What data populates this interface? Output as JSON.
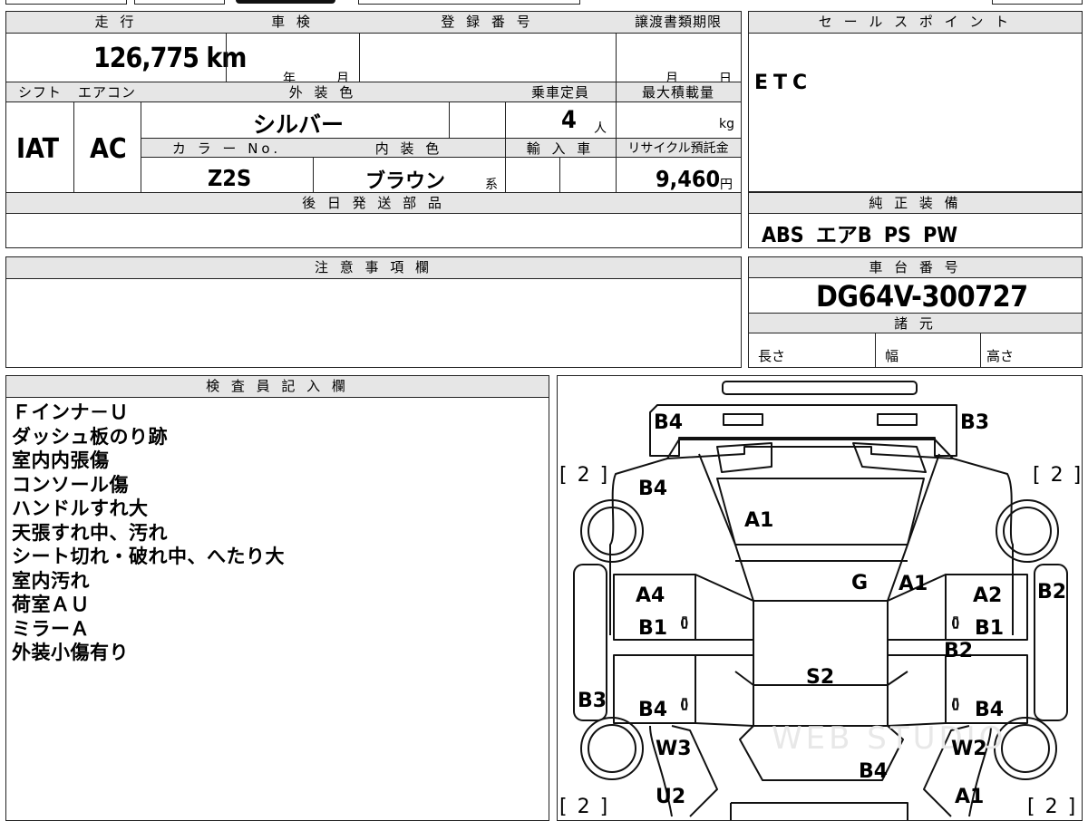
{
  "top_table": {
    "h_mileage": "走 行",
    "h_shaken": "車 検",
    "h_registration": "登 録 番 号",
    "h_transfer_deadline": "譲渡書類期限",
    "mileage": "126,775 km",
    "shaken_year_unit": "年",
    "shaken_month_unit": "月",
    "transfer_month_unit": "月",
    "transfer_day_unit": "日",
    "h_shift": "シフト",
    "h_aircon": "エアコン",
    "h_exterior_color": "外 装 色",
    "h_capacity": "乗車定員",
    "h_max_load": "最大積載量",
    "shift": "IAT",
    "aircon": "AC",
    "exterior_color": "シルバー",
    "capacity": "4",
    "capacity_unit": "人",
    "max_load_unit": "kg",
    "h_color_no": "カ ラ ー No.",
    "h_interior_color": "内 装 色",
    "h_import": "輸 入 車",
    "h_recycle": "リサイクル預託金",
    "color_no": "Z2S",
    "interior_color": "ブラウン",
    "interior_suffix": "系",
    "recycle_fee": "9,460",
    "recycle_unit": "円",
    "h_later_parts": "後 日 発 送 部 品",
    "later_parts": ""
  },
  "sales_point": {
    "header": "セ ー ル ス ポ イ ン ト",
    "text": "ETC"
  },
  "genuine_equipment": {
    "header": "純 正 装 備",
    "text": "ABS エアB PS PW"
  },
  "notes_section": {
    "header": "注 意 事 項 欄",
    "text": ""
  },
  "chassis": {
    "header": "車 台 番 号",
    "number": "DG64V-300727",
    "spec_header": "諸 元",
    "length_label": "長さ",
    "width_label": "幅",
    "height_label": "高さ"
  },
  "inspector": {
    "header": "検 査 員 記 入 欄",
    "lines": [
      "Ｆインナ－Ｕ",
      "ダッシュ板のり跡",
      "室内内張傷",
      "コンソール傷",
      "ハンドルすれ大",
      "天張すれ中、汚れ",
      "シート切れ・破れ中、へたり大",
      "室内汚れ",
      "荷室ＡＵ",
      "ミラーＡ",
      "外装小傷有り"
    ]
  },
  "diagram": {
    "marks": {
      "rear_left": "B4",
      "rear_right": "B3",
      "tyre_rl": "[ 2 ]",
      "tyre_rr": "[ 2 ]",
      "tyre_fl": "[ 2 ]",
      "tyre_fr": "[ 2 ]",
      "rear_door_left": "B4",
      "rear_glass": "A1",
      "quarter_left": "A4",
      "door_left_b1": "B1",
      "roof_g": "G",
      "roof_a1": "A1",
      "quarter_right": "A2",
      "door_right_b1": "B1",
      "side_right": "B2",
      "pillar_right": "B2",
      "roof": "S2",
      "side_left": "B3",
      "front_door_left": "B4",
      "front_door_right": "B4",
      "fender_left": "W3",
      "fender_right": "W2",
      "hood": "B4",
      "front_left": "U2",
      "front_right": "A1",
      "zero_l1": "0",
      "zero_r1": "0",
      "zero_l2": "0",
      "zero_r2": "0"
    },
    "watermark": "WEB STUDIO"
  }
}
